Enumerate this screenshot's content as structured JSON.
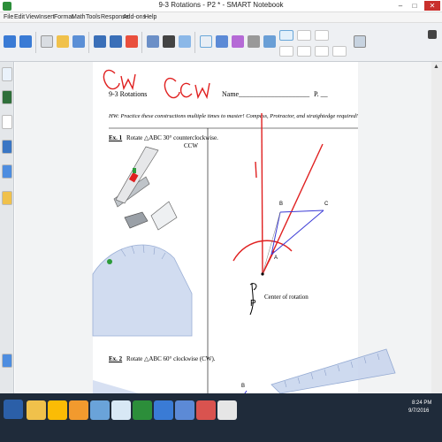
{
  "window": {
    "title": "9-3 Rotations - P2 * - SMART Notebook"
  },
  "menu": [
    "File",
    "Edit",
    "View",
    "Insert",
    "Format",
    "Math",
    "Tools",
    "Response",
    "Add-ons",
    "Help"
  ],
  "worksheet": {
    "header": "9-3 Rotations",
    "name_label": "Name____________________",
    "period_label": "P. __",
    "hw_note": "HW: Practice these constructions multiple times to master! Compass, Protractor, and straightedge required!",
    "ex1_num": "Ex. 1",
    "ex1_text": "Rotate △ABC 30° counterclockwise.",
    "ex1_abbrev": "CCW",
    "ex2_num": "Ex. 2",
    "ex2_text": "Rotate △ABC 60° clockwise (CW).",
    "center_label": "Center of rotation",
    "point_b": "B",
    "point_c": "C",
    "point_a": "A",
    "point_p": "P",
    "point_b2": "B"
  },
  "annotations": {
    "cw": "CW",
    "ccw": "CCW",
    "mark": "1"
  },
  "tray": {
    "time": "8:24 PM",
    "date": "9/7/2016"
  },
  "colors": {
    "ink_red": "#e02020",
    "triangle_blue": "#3b3bd6",
    "taskbar": "#1f2b3a"
  }
}
